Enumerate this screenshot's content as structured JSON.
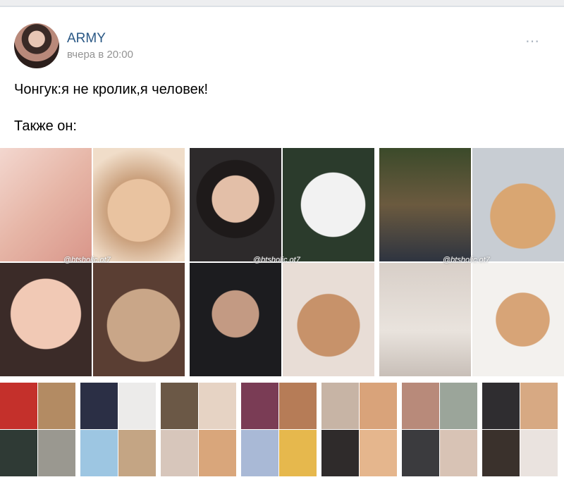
{
  "post": {
    "author": "ARMY",
    "time": "вчера в 20:00",
    "more_icon": "⋯",
    "text_line1": "Чонгук:я не кролик,я человек!",
    "text_line2": "Также он:"
  },
  "images": {
    "watermark": "@btsholic.ot7",
    "big_collages": 3,
    "thumbnail_collages": 7
  },
  "icons": [
    "avatar-photo",
    "more-dots-icon"
  ]
}
